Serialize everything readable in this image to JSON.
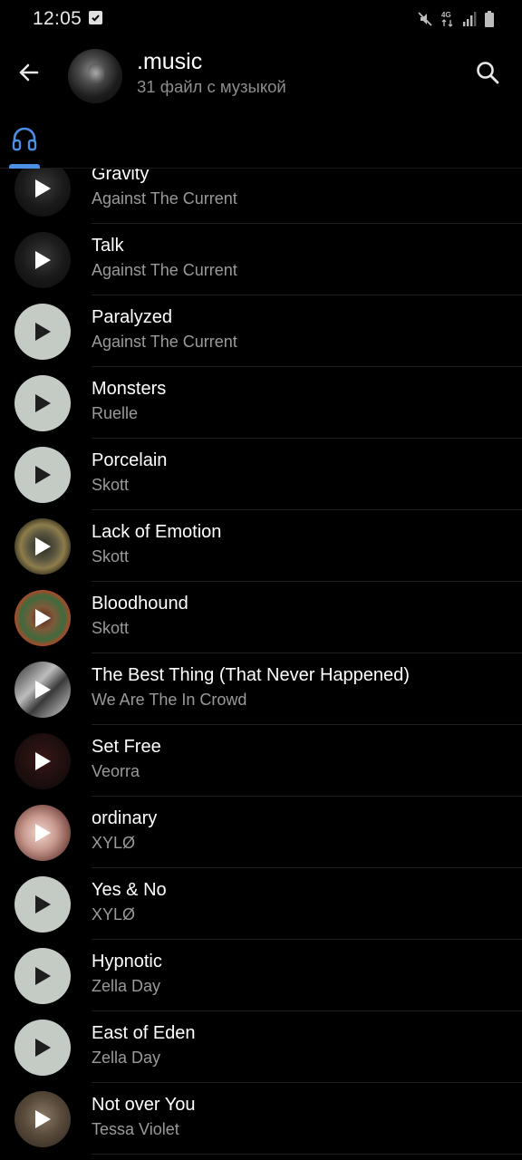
{
  "status": {
    "time": "12:05",
    "network": "4G"
  },
  "header": {
    "title": ".music",
    "subtitle": "31 файл с музыкой"
  },
  "icons": {
    "back": "arrow-left",
    "search": "magnifier",
    "tab": "headphones",
    "play": "play-triangle"
  },
  "colors": {
    "accent": "#4d8fe4",
    "background": "#000000",
    "subtitle": "#8e8e8e",
    "play_circle": "#c4cbc4"
  },
  "tracks": [
    {
      "title": "Gravity",
      "artist": "Against The Current",
      "art": "atc"
    },
    {
      "title": "Talk",
      "artist": "Against The Current",
      "art": "atc"
    },
    {
      "title": "Paralyzed",
      "artist": "Against The Current",
      "art": "plain"
    },
    {
      "title": "Monsters",
      "artist": "Ruelle",
      "art": "plain"
    },
    {
      "title": "Porcelain",
      "artist": "Skott",
      "art": "plain"
    },
    {
      "title": "Lack of Emotion",
      "artist": "Skott",
      "art": "emotion"
    },
    {
      "title": "Bloodhound",
      "artist": "Skott",
      "art": "blood"
    },
    {
      "title": "The Best Thing (That Never Happened)",
      "artist": "We Are The In Crowd",
      "art": "crowd"
    },
    {
      "title": "Set Free",
      "artist": "Veorra",
      "art": "veorra"
    },
    {
      "title": "ordinary",
      "artist": "XYLØ",
      "art": "ordinary"
    },
    {
      "title": "Yes & No",
      "artist": "XYLØ",
      "art": "plain"
    },
    {
      "title": "Hypnotic",
      "artist": "Zella Day",
      "art": "plain"
    },
    {
      "title": "East of Eden",
      "artist": "Zella Day",
      "art": "plain"
    },
    {
      "title": "Not over You",
      "artist": "Tessa Violet",
      "art": "tessa"
    }
  ]
}
